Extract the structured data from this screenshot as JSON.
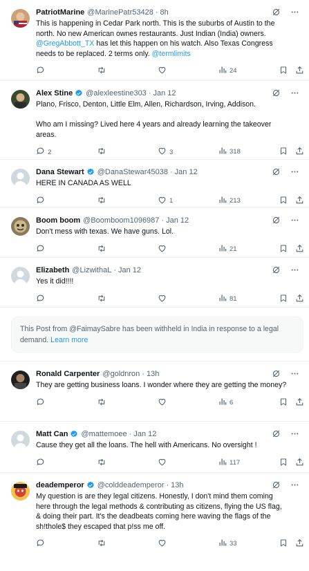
{
  "tweets": [
    {
      "name": "PatriotMarine",
      "handle": "@MarinePatr53428",
      "time": "8h",
      "verified": false,
      "body_a": "This is happening in Cedar Park north.  This is the suburbs of Austin to the north.  No new American ownes restaurants.  Just Indian (India) owners.  ",
      "mention": "@GregAbbott_TX",
      "body_b": " has let this happen on his watch.  Also Texas Congress needs to be replaced.  2 terms only.  ",
      "hashtag": "@termlimits",
      "replies": "",
      "retweets": "",
      "likes": "",
      "views": "24"
    },
    {
      "name": "Alex Stine",
      "handle": "@alexleestine303",
      "time": "Jan 12",
      "verified": true,
      "body_p1": "Plano, Frisco, Denton, Little Elm, Allen, Richardson, Irving, Addison.",
      "body_p2": "Who am I missing? Lived here 4 years and already learning the takeover areas.",
      "replies": "2",
      "retweets": "",
      "likes": "3",
      "views": "318"
    },
    {
      "name": "Dana Stewart",
      "handle": "@DanaStewar45038",
      "time": "Jan 12",
      "verified": true,
      "body": "HERE IN CANADA AS WELL",
      "replies": "",
      "retweets": "",
      "likes": "1",
      "views": "213"
    },
    {
      "name": "Boom boom",
      "handle": "@Boomboom1096987",
      "time": "Jan 12",
      "verified": false,
      "body": "Don't mess with texas. We have guns. Lol.",
      "replies": "",
      "retweets": "",
      "likes": "",
      "views": "21"
    },
    {
      "name": "Elizabeth",
      "handle": "@LizwithaL",
      "time": "Jan 12",
      "verified": false,
      "body": "Yes it did!!!!",
      "replies": "",
      "retweets": "",
      "likes": "",
      "views": "81"
    },
    {
      "name": "Ronald Carpenter",
      "handle": "@goldnron",
      "time": "13h",
      "verified": false,
      "body": "They are getting business loans. I wonder where they are getting the money?",
      "replies": "",
      "retweets": "",
      "likes": "",
      "views": "6"
    },
    {
      "name": "Matt Can",
      "handle": "@mattemoee",
      "time": "Jan 12",
      "verified": true,
      "body": "Cause they get all the loans. The hell with Americans. No oversight !",
      "replies": "",
      "retweets": "",
      "likes": "",
      "views": "117"
    },
    {
      "name": "deademperor",
      "handle": "@colddeademperor",
      "time": "13h",
      "verified": true,
      "body": "My question is are they legal citizens. Honestly, I don't mind them coming here through the legal methods & contributing as citizens, flying the US flag, & doing their part. It's the deadbeats coming here waving the flags of the sh!thole$ they escaped that p!ss me off.",
      "replies": "",
      "retweets": "",
      "likes": "",
      "views": "33"
    }
  ],
  "withheld": {
    "text": "This Post from @FaimaySabre has been withheld in India in response to a legal demand. ",
    "learn_more": "Learn more"
  },
  "colors": {
    "accent": "#1d9bf0",
    "text": "#0f1419",
    "secondary": "#536471",
    "border": "#eff3f4"
  }
}
